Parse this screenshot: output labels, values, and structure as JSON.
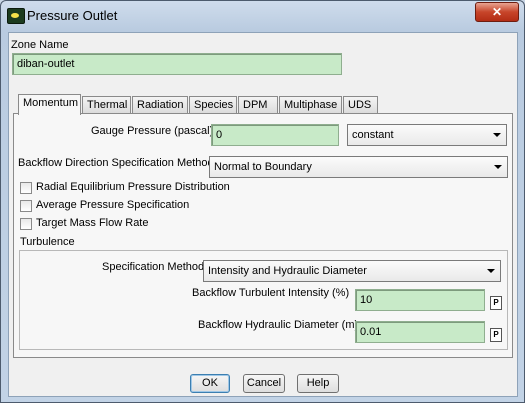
{
  "window": {
    "title": "Pressure Outlet",
    "close_label": "✕"
  },
  "zone": {
    "label": "Zone Name",
    "value": "diban-outlet"
  },
  "tabs": [
    {
      "label": "Momentum",
      "active": true
    },
    {
      "label": "Thermal"
    },
    {
      "label": "Radiation"
    },
    {
      "label": "Species"
    },
    {
      "label": "DPM"
    },
    {
      "label": "Multiphase"
    },
    {
      "label": "UDS"
    }
  ],
  "momentum": {
    "gauge_pressure_label": "Gauge Pressure (pascal)",
    "gauge_pressure_value": "0",
    "gauge_pressure_profile": "constant",
    "backflow_direction_label": "Backflow Direction Specification Method",
    "backflow_direction_value": "Normal to Boundary",
    "checkboxes": [
      {
        "label": "Radial Equilibrium Pressure Distribution",
        "checked": false
      },
      {
        "label": "Average Pressure Specification",
        "checked": false
      },
      {
        "label": "Target Mass Flow Rate",
        "checked": false
      }
    ],
    "turbulence": {
      "label": "Turbulence",
      "spec_method_label": "Specification Method",
      "spec_method_value": "Intensity and Hydraulic Diameter",
      "intensity_label": "Backflow Turbulent Intensity (%)",
      "intensity_value": "10",
      "diameter_label": "Backflow Hydraulic Diameter (m)",
      "diameter_value": "0.01",
      "param_button_label": "P"
    }
  },
  "buttons": {
    "ok": "OK",
    "cancel": "Cancel",
    "help": "Help"
  }
}
